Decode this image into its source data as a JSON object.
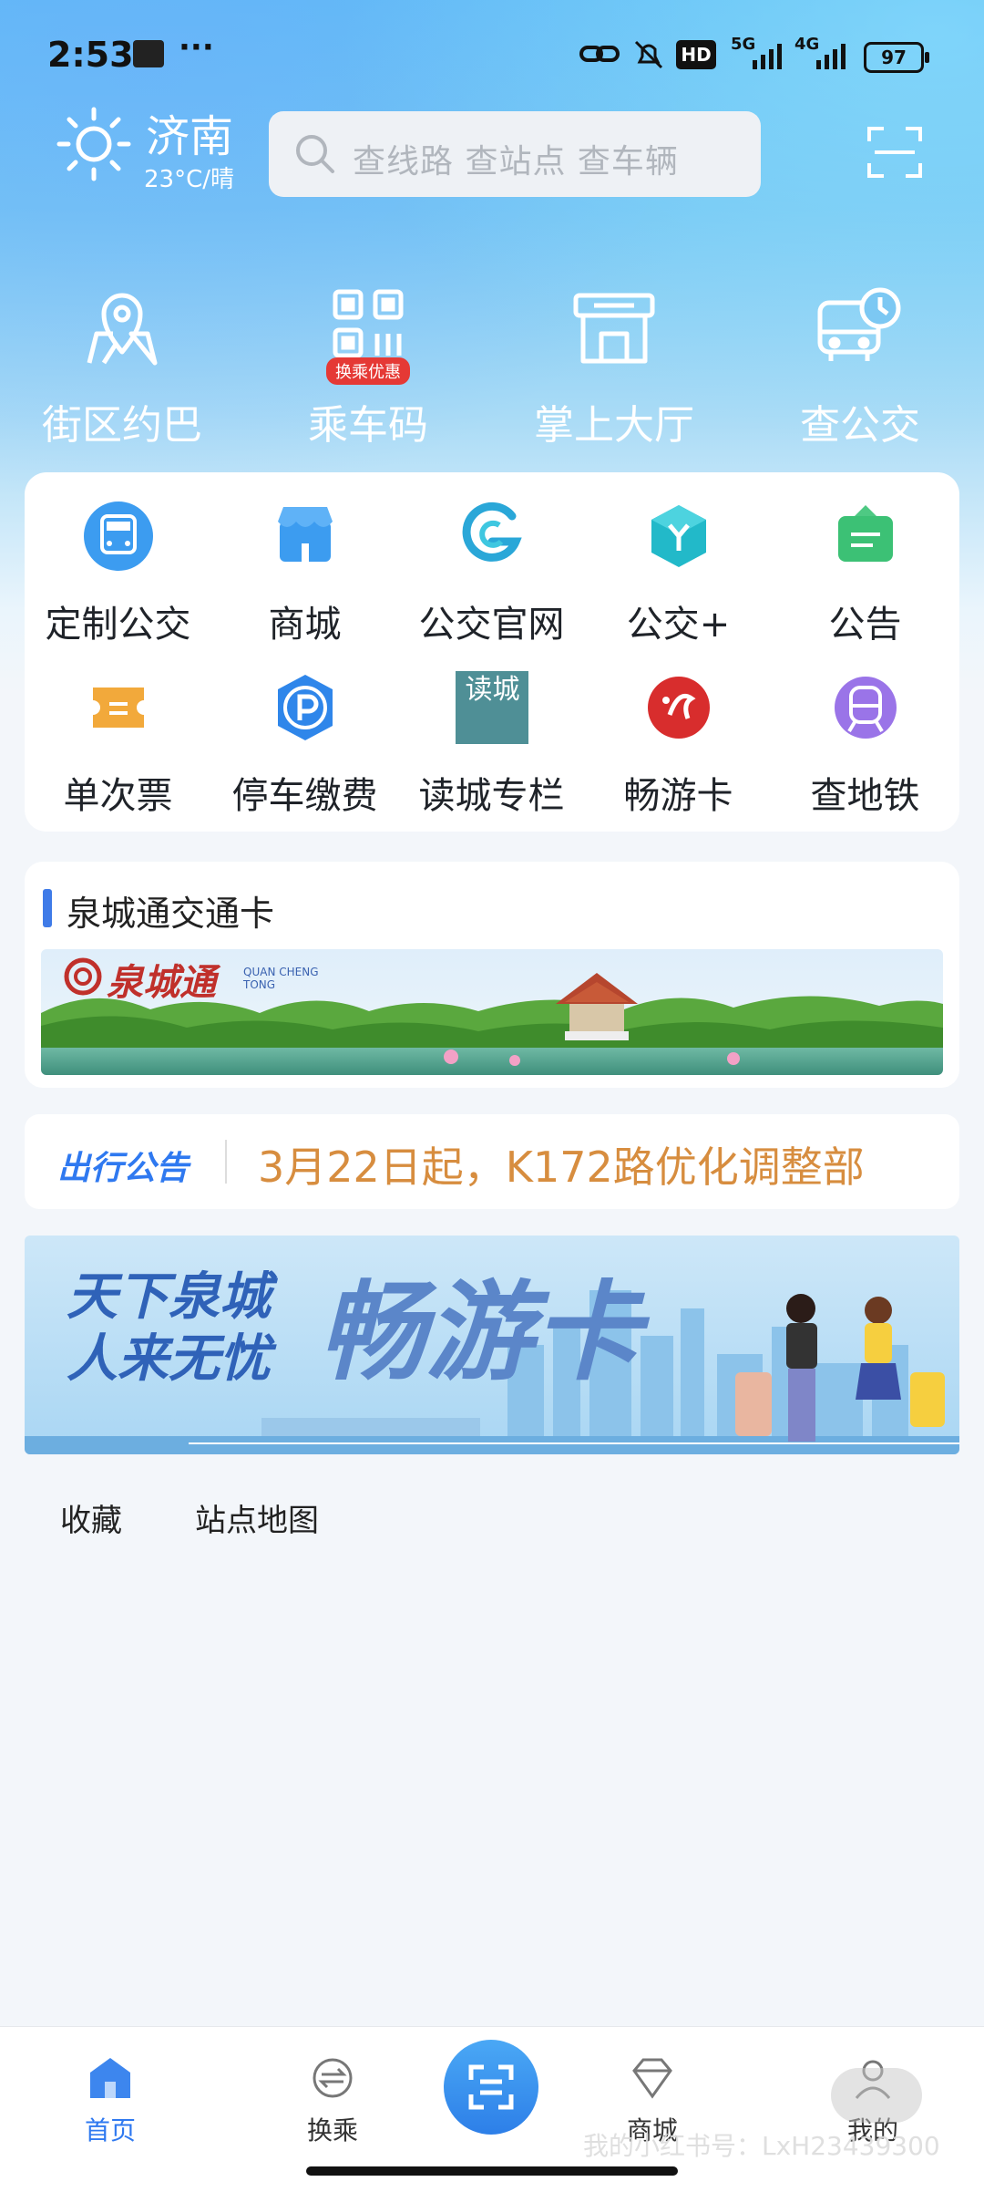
{
  "status_bar": {
    "time": "2:53",
    "more": "···",
    "network_5g": "5G",
    "network_4g": "4G",
    "battery": "97"
  },
  "header": {
    "city": "济南",
    "weather": "23°C/晴",
    "search_placeholder": "查线路 查站点 查车辆"
  },
  "quick_actions": [
    {
      "label": "街区约巴",
      "icon": "map-pin-icon"
    },
    {
      "label": "乘车码",
      "icon": "qr-code-icon",
      "badge": "换乘优惠"
    },
    {
      "label": "掌上大厅",
      "icon": "hall-icon"
    },
    {
      "label": "查公交",
      "icon": "bus-clock-icon"
    }
  ],
  "grid": [
    {
      "label": "定制公交",
      "icon": "custom-bus-icon"
    },
    {
      "label": "商城",
      "icon": "shop-icon"
    },
    {
      "label": "公交官网",
      "icon": "official-site-icon"
    },
    {
      "label": "公交+",
      "icon": "bus-plus-icon"
    },
    {
      "label": "公告",
      "icon": "notice-icon"
    },
    {
      "label": "单次票",
      "icon": "ticket-icon"
    },
    {
      "label": "停车缴费",
      "icon": "parking-icon"
    },
    {
      "label": "读城专栏",
      "icon": "read-city-icon",
      "art_text": "读城"
    },
    {
      "label": "畅游卡",
      "icon": "tour-card-icon"
    },
    {
      "label": "查地铁",
      "icon": "metro-icon"
    }
  ],
  "card_section": {
    "title": "泉城通交通卡",
    "banner_text": "泉城通",
    "banner_sub": "QUAN CHENG TONG"
  },
  "notice": {
    "tag": "出行公告",
    "text": "3月22日起，K172路优化调整部"
  },
  "promo_banner": {
    "line1": "天下泉城",
    "line2": "人来无忧",
    "big": "畅游卡"
  },
  "sub_tabs": [
    "收藏",
    "站点地图"
  ],
  "bottom_nav": [
    {
      "label": "首页",
      "active": true
    },
    {
      "label": "换乘",
      "active": false
    },
    {
      "label": "商城",
      "active": false
    },
    {
      "label": "我的",
      "active": false
    }
  ],
  "watermark": "我的小红书号：LxH23439300",
  "colors": {
    "accent": "#2f79f0",
    "notice_text": "#d78d3f",
    "badge": "#e53935"
  }
}
